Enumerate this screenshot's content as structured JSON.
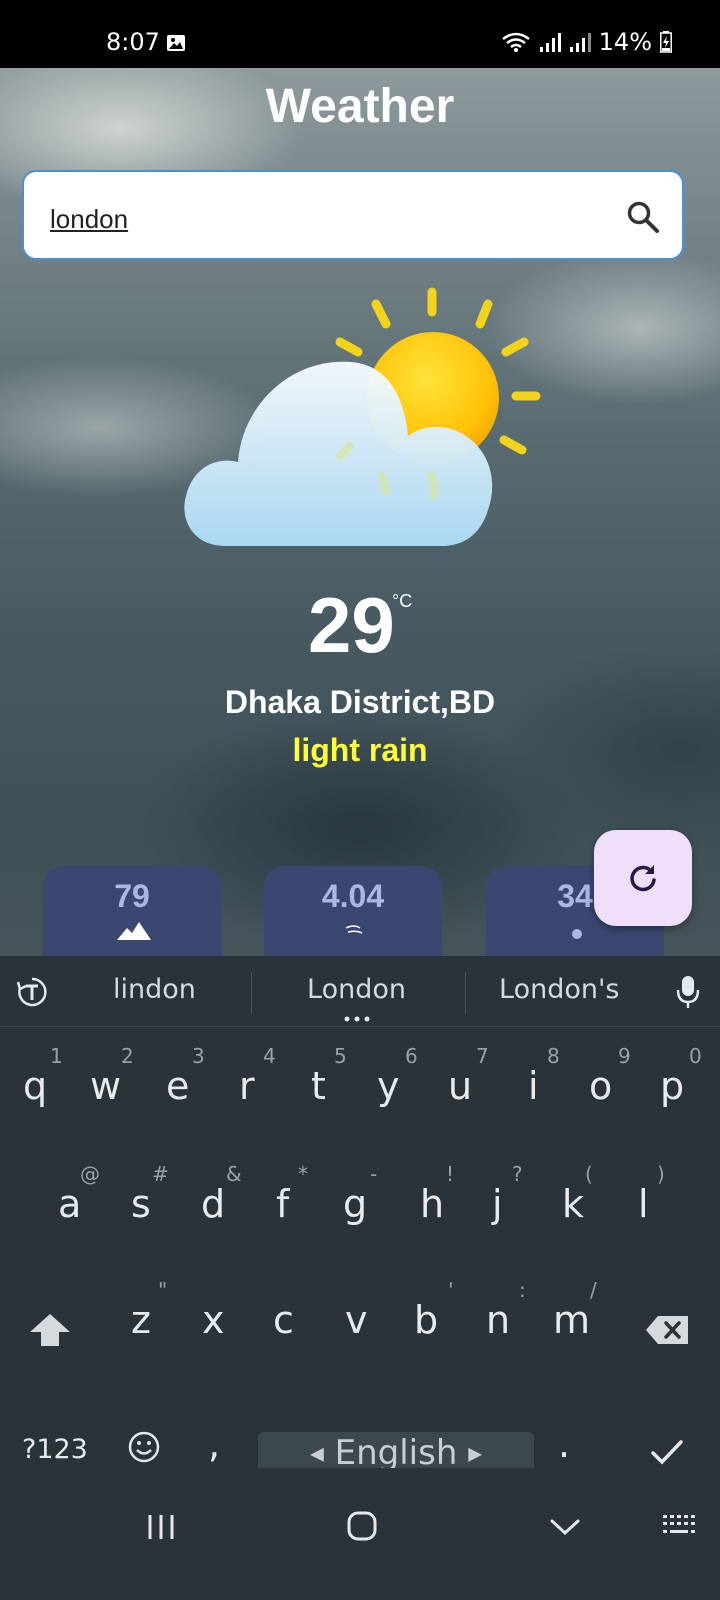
{
  "status": {
    "time": "8:07",
    "battery": "14%",
    "icons": [
      "image-icon",
      "wifi-icon",
      "signal-icon",
      "signal-icon",
      "battery-charging-icon"
    ]
  },
  "app": {
    "title": "Weather",
    "search": {
      "value": "london",
      "icon": "search-icon"
    },
    "temperature": "29",
    "unit": "°C",
    "location": "Dhaka District,BD",
    "description": "light rain",
    "cards": [
      {
        "value": "79"
      },
      {
        "value": "4.04"
      },
      {
        "value": "34"
      }
    ],
    "refresh_icon": "refresh-icon",
    "colors": {
      "accent_text": "#ffff33",
      "card_bg": "#3a4770",
      "fab_bg": "#efdffb"
    }
  },
  "keyboard": {
    "suggestions": [
      "lindon",
      "London",
      "London's"
    ],
    "rows": [
      {
        "keys": [
          "q",
          "w",
          "e",
          "r",
          "t",
          "y",
          "u",
          "i",
          "o",
          "p"
        ],
        "hints": [
          "1",
          "2",
          "3",
          "4",
          "5",
          "6",
          "7",
          "8",
          "9",
          "0"
        ]
      },
      {
        "keys": [
          "a",
          "s",
          "d",
          "f",
          "g",
          "h",
          "j",
          "k",
          "l"
        ],
        "hints": [
          "@",
          "#",
          "&",
          "*",
          "-",
          "!",
          "?",
          "(",
          ")"
        ]
      },
      {
        "keys": [
          "z",
          "x",
          "c",
          "v",
          "b",
          "n",
          "m"
        ],
        "hints": [
          "\"",
          "",
          "",
          "",
          "'",
          ":",
          "/"
        ]
      }
    ],
    "symbols_key": "?123",
    "comma": ",",
    "space_label": "English",
    "period": "."
  }
}
